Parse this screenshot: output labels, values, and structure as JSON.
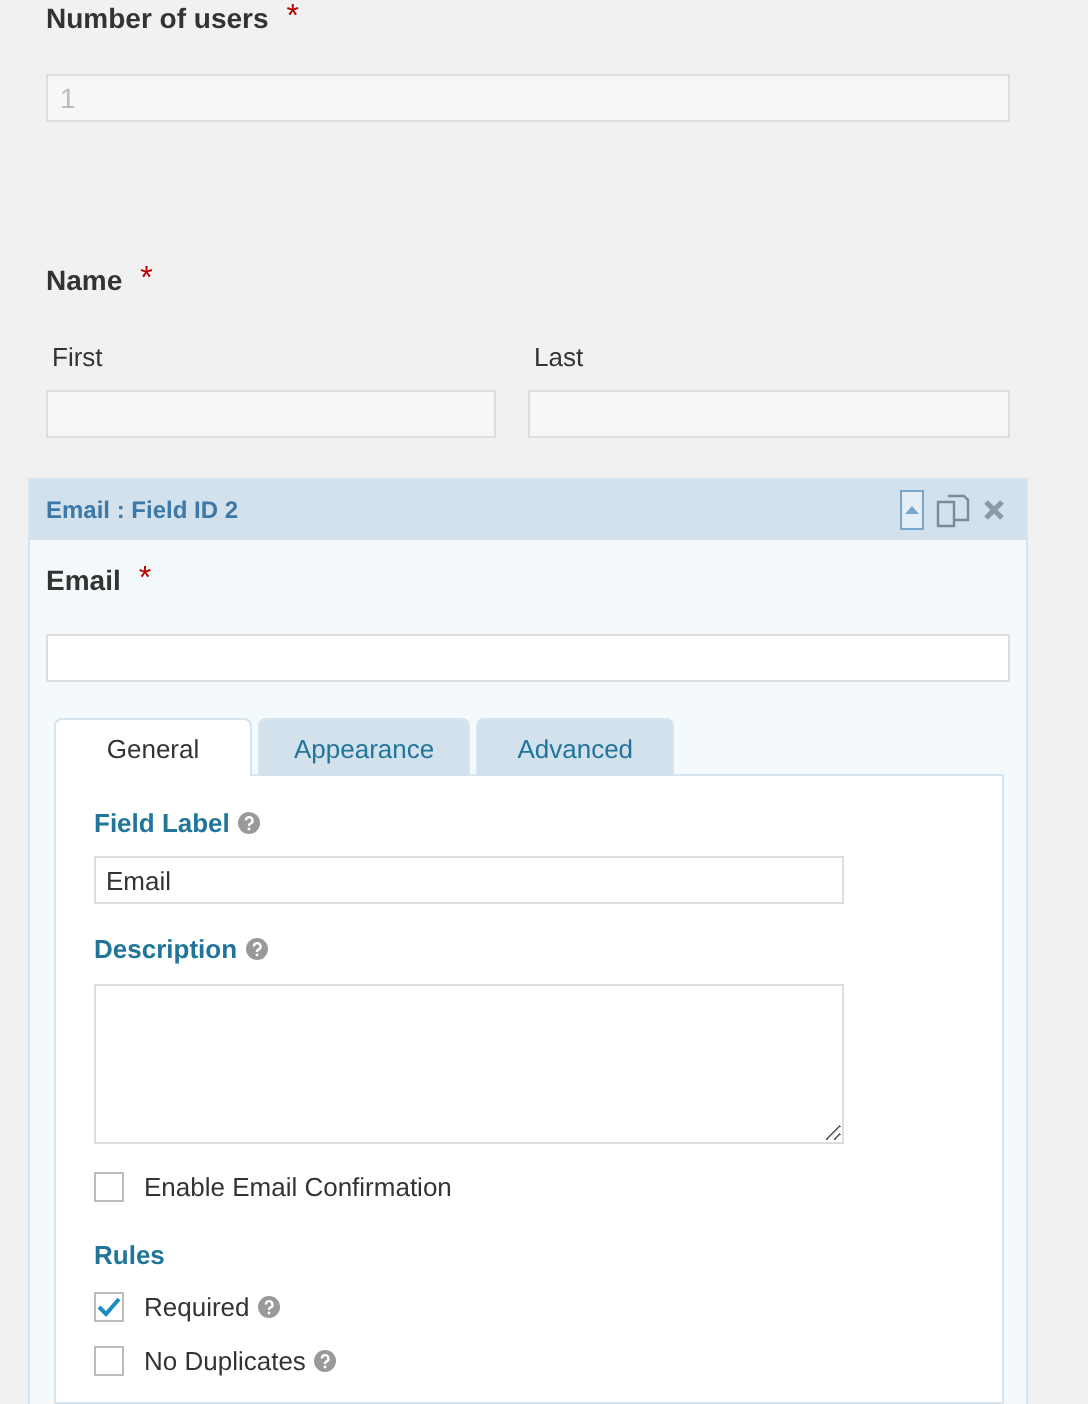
{
  "fields": [
    {
      "kind": "single",
      "label": "Number of users",
      "required_mark": "*",
      "placeholder": "1"
    },
    {
      "kind": "name",
      "label": "Name",
      "required_mark": "*",
      "subfields": [
        {
          "label": "First"
        },
        {
          "label": "Last"
        }
      ]
    }
  ],
  "editor": {
    "title": "Email : Field ID 2",
    "label": "Email",
    "required_mark": "*",
    "tabs": [
      {
        "label": "General",
        "selected": true
      },
      {
        "label": "Appearance",
        "selected": false
      },
      {
        "label": "Advanced",
        "selected": false
      }
    ],
    "settings": [
      {
        "kind": "text",
        "label": "Field Label",
        "help": true,
        "value": "Email"
      },
      {
        "kind": "textarea",
        "label": "Description",
        "help": true
      },
      {
        "kind": "check",
        "label": "Enable Email Confirmation",
        "checked": false,
        "help": false
      },
      {
        "kind": "heading",
        "label": "Rules",
        "help": false
      },
      {
        "kind": "check",
        "label": "Required",
        "checked": true,
        "help": true
      },
      {
        "kind": "check",
        "label": "No Duplicates",
        "checked": false,
        "help": true
      }
    ]
  }
}
